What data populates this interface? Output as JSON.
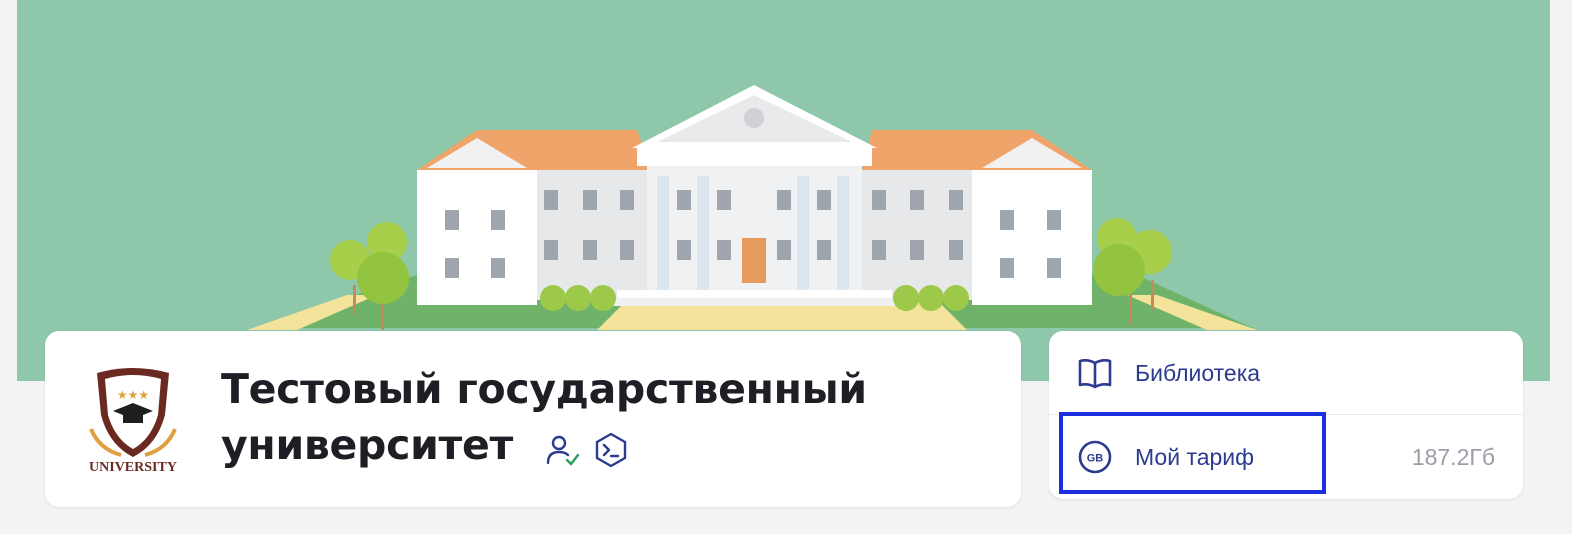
{
  "organization": {
    "name": "Тестовый государственный университет",
    "logo_text": "UNIVERSITY",
    "badges": [
      "verified-user-icon",
      "terminal-hexagon-icon"
    ]
  },
  "side_menu": {
    "items": [
      {
        "label": "Библиотека",
        "icon": "book-icon",
        "value": ""
      },
      {
        "label": "Мой тариф",
        "icon": "gb-circle-icon",
        "value": "187.2Гб"
      }
    ]
  },
  "colors": {
    "banner_bg": "#8fc7aa",
    "accent": "#2c3a8f",
    "highlight": "#1b2fe0"
  }
}
